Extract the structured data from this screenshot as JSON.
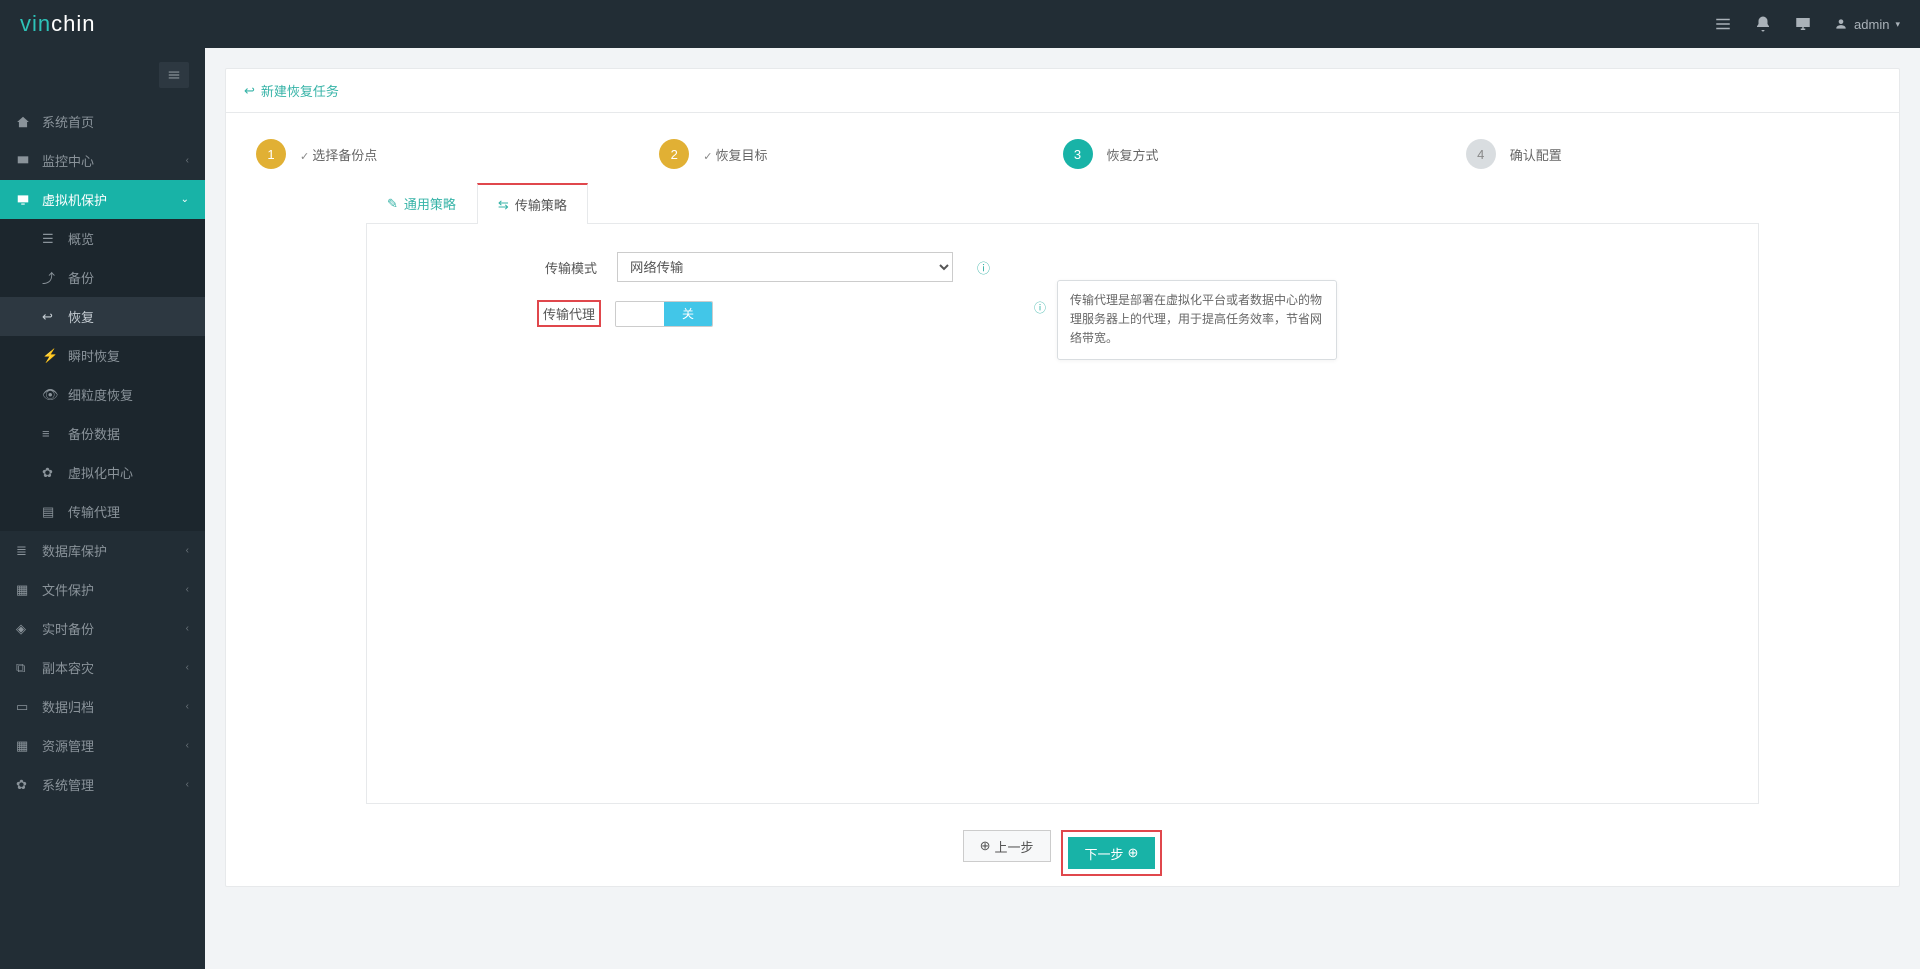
{
  "brand": {
    "part1": "vin",
    "part2": "chin"
  },
  "user": {
    "name": "admin"
  },
  "sidebar": {
    "items": [
      {
        "label": "系统首页"
      },
      {
        "label": "监控中心"
      },
      {
        "label": "虚拟机保护"
      },
      {
        "label": "数据库保护"
      },
      {
        "label": "文件保护"
      },
      {
        "label": "实时备份"
      },
      {
        "label": "副本容灾"
      },
      {
        "label": "数据归档"
      },
      {
        "label": "资源管理"
      },
      {
        "label": "系统管理"
      }
    ],
    "sub": [
      {
        "label": "概览"
      },
      {
        "label": "备份"
      },
      {
        "label": "恢复"
      },
      {
        "label": "瞬时恢复"
      },
      {
        "label": "细粒度恢复"
      },
      {
        "label": "备份数据"
      },
      {
        "label": "虚拟化中心"
      },
      {
        "label": "传输代理"
      }
    ]
  },
  "page": {
    "title": "新建恢复任务"
  },
  "wizard": {
    "steps": [
      {
        "num": "1",
        "label": "选择备份点"
      },
      {
        "num": "2",
        "label": "恢复目标"
      },
      {
        "num": "3",
        "label": "恢复方式"
      },
      {
        "num": "4",
        "label": "确认配置"
      }
    ]
  },
  "tabs": {
    "general": "通用策略",
    "transfer": "传输策略"
  },
  "form": {
    "mode_label": "传输模式",
    "mode_value": "网络传输",
    "proxy_label": "传输代理",
    "toggle_off": "",
    "toggle_on": "关"
  },
  "tooltip": "传输代理是部署在虚拟化平台或者数据中心的物理服务器上的代理，用于提高任务效率，节省网络带宽。",
  "buttons": {
    "prev": "上一步",
    "next": "下一步"
  }
}
